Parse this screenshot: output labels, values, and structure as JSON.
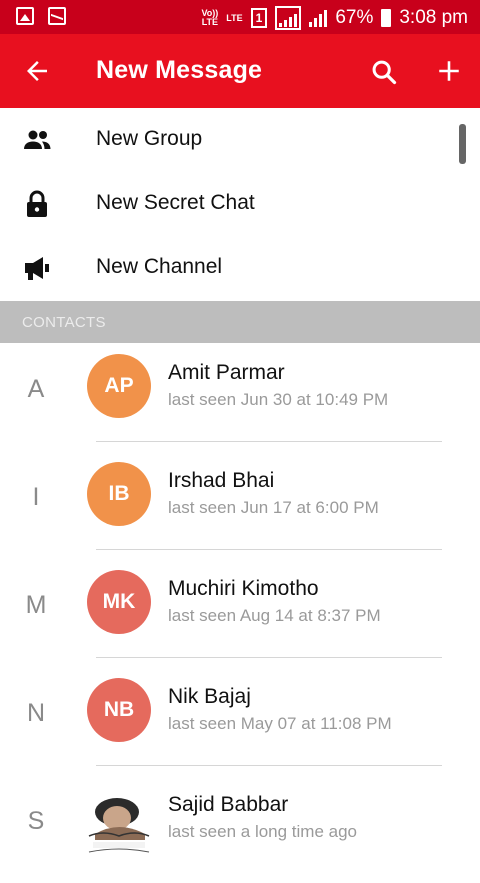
{
  "status_bar": {
    "volte": "Vo))",
    "lte1": "LTE",
    "lte2": "LTE",
    "sim": "1",
    "battery": "67%",
    "time": "3:08 pm"
  },
  "app_bar": {
    "title": "New Message",
    "back_icon": "arrow-left-icon",
    "search_icon": "search-icon",
    "add_icon": "plus-icon"
  },
  "menu": [
    {
      "label": "New Group",
      "icon": "group-icon"
    },
    {
      "label": "New Secret Chat",
      "icon": "lock-icon"
    },
    {
      "label": "New Channel",
      "icon": "megaphone-icon"
    }
  ],
  "section_header": "CONTACTS",
  "contacts": [
    {
      "letter": "A",
      "initials": "AP",
      "name": "Amit Parmar",
      "last_seen": "last seen Jun 30 at 10:49 PM",
      "color": "#f1924a"
    },
    {
      "letter": "I",
      "initials": "IB",
      "name": "Irshad Bhai",
      "last_seen": "last seen Jun 17 at 6:00 PM",
      "color": "#f1924a"
    },
    {
      "letter": "M",
      "initials": "MK",
      "name": "Muchiri Kimotho",
      "last_seen": "last seen Aug 14 at 8:37 PM",
      "color": "#e56a5d"
    },
    {
      "letter": "N",
      "initials": "NB",
      "name": "Nik Bajaj",
      "last_seen": "last seen May 07 at 11:08 PM",
      "color": "#e56a5d"
    },
    {
      "letter": "S",
      "photo": "profile-photo",
      "name": "Sajid Babbar",
      "last_seen": "last seen a long time ago"
    }
  ],
  "colors": {
    "status_bar": "#c8001b",
    "app_bar": "#e8101f",
    "section": "#bdbdbd"
  }
}
